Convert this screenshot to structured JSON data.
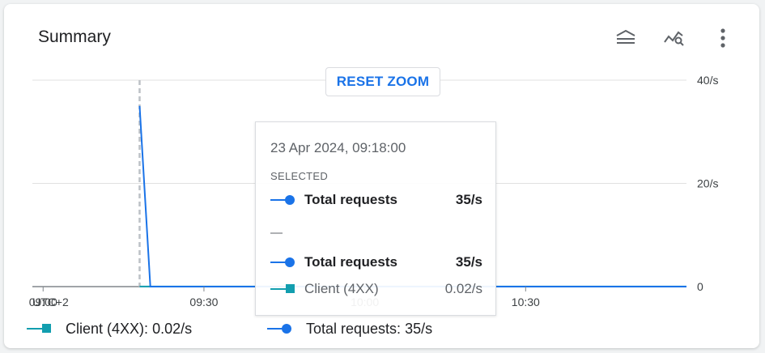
{
  "card": {
    "title": "Summary"
  },
  "toolbar": {
    "icons": [
      "legend-toggle-icon",
      "explore-chart-icon",
      "more-vert-icon"
    ]
  },
  "reset_zoom_label": "RESET ZOOM",
  "tooltip": {
    "date": "23 Apr 2024, 09:18:00",
    "selected_label": "SELECTED",
    "selected": {
      "name": "Total requests",
      "value": "35/s"
    },
    "divider": "—",
    "rows": [
      {
        "name": "Total requests",
        "value": "35/s"
      },
      {
        "name": "Client (4XX)",
        "value": "0.02/s"
      }
    ]
  },
  "legend": [
    {
      "label": "Client (4XX):",
      "value": "0.02/s"
    },
    {
      "label": "Total requests:",
      "value": "35/s"
    }
  ],
  "colors": {
    "total_requests": "#1a73e8",
    "client_4xx": "#129eaf",
    "accent": "#1a73e8"
  },
  "chart_data": {
    "type": "line",
    "timezone_label": "UTC+2",
    "x_ticks": [
      "09:00",
      "09:30",
      "10:00",
      "10:30"
    ],
    "y_ticks": [
      "0",
      "20/s",
      "40/s"
    ],
    "ylim": [
      0,
      40
    ],
    "xlim": [
      "08:58",
      "11:00"
    ],
    "selected_x": "09:18",
    "series": [
      {
        "name": "Total requests",
        "x": [
          "09:18",
          "09:20",
          "11:00"
        ],
        "values": [
          35,
          0,
          0
        ]
      },
      {
        "name": "Client (4XX)",
        "x": [
          "09:18",
          "11:00"
        ],
        "values": [
          0.02,
          0.02
        ]
      }
    ],
    "grid": true,
    "legend_position": "bottom"
  }
}
